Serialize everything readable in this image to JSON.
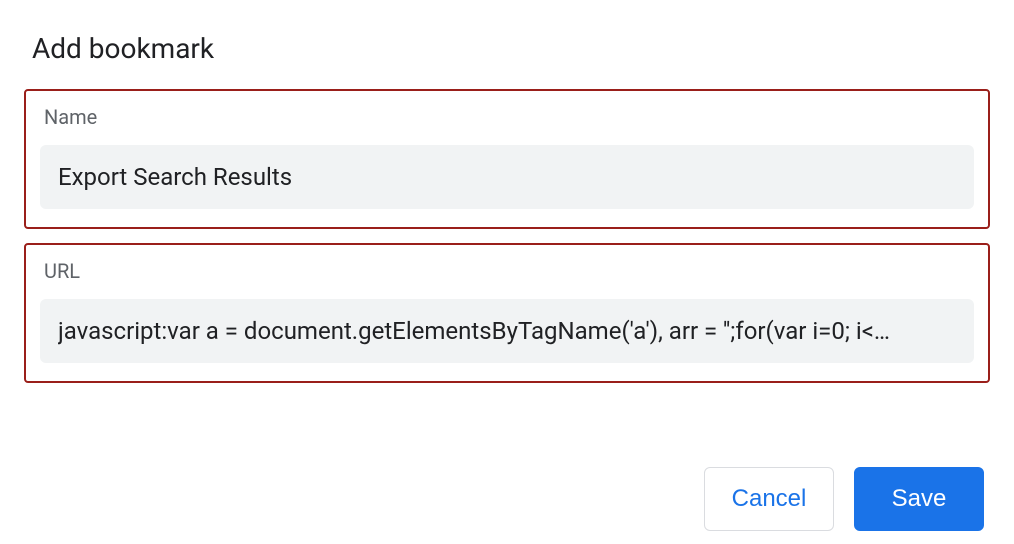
{
  "dialog": {
    "title": "Add bookmark"
  },
  "fields": {
    "name": {
      "label": "Name",
      "value": "Export Search Results"
    },
    "url": {
      "label": "URL",
      "value": "javascript:var a = document.getElementsByTagName('a'), arr = '';for(var i=0; i<…"
    }
  },
  "buttons": {
    "cancel": "Cancel",
    "save": "Save"
  },
  "colors": {
    "highlight_border": "#9a1f1a",
    "primary": "#1a73e8",
    "input_bg": "#f1f3f4",
    "label_text": "#5f6368"
  }
}
